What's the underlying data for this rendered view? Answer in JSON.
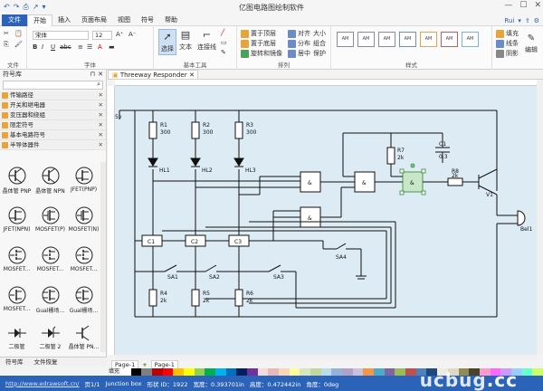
{
  "app_title": "亿图电路图绘制软件",
  "quick_access": [
    "↶",
    "↷",
    "⎙",
    "↗",
    "▾"
  ],
  "window_controls": [
    "—",
    "☐",
    "✕"
  ],
  "menu": [
    "文件",
    "开始",
    "插入",
    "页面布局",
    "视图",
    "符号",
    "帮助"
  ],
  "user": "Rui",
  "ribbon": {
    "file_group_label": "文件",
    "font_group_label": "字体",
    "tools_group_label": "基本工具",
    "arrange_group_label": "排列",
    "style_group_label": "样式",
    "edit_group_label": "编辑",
    "font_name": "宋体",
    "font_size": "12",
    "select_label": "选择",
    "text_label": "文本",
    "connector_label": "连接线",
    "arrange_items": [
      "置于顶层",
      "对齐",
      "大小",
      "置于底层",
      "分布",
      "组合",
      "旋转和镜像",
      "居中",
      "保护"
    ],
    "style_box_text": "AM",
    "fill_label": "填充",
    "line_label": "线条",
    "shadow_label": "阴影",
    "edit_label": "编辑"
  },
  "library": {
    "title": "符号库",
    "categories": [
      "传输路径",
      "开关和继电器",
      "变压器和绕组",
      "限定符号",
      "基本电路符号",
      "半导体器件"
    ],
    "shapes": [
      "晶体管 PNP",
      "晶体管 NPN",
      "JFET(PNP)",
      "JFET(NPN)",
      "MOSFET(P)",
      "MOSFET(N)",
      "MOSFET...",
      "MOSFET...",
      "MOSFET...",
      "MOSFET...",
      "Gual栅场...",
      "Gual栅场...",
      "二极管",
      "二极管 2",
      "晶体管 PN..."
    ],
    "bottom_tabs": [
      "符号库",
      "文件恢复"
    ]
  },
  "document_tab": "Threeway Responder",
  "circuit": {
    "source_label": "5v",
    "resistors_top": [
      {
        "label": "R1",
        "value": "300"
      },
      {
        "label": "R2",
        "value": "300"
      },
      {
        "label": "R3",
        "value": "300"
      }
    ],
    "leds": [
      "HL1",
      "HL2",
      "HL3"
    ],
    "latches": [
      "C1",
      "C2",
      "C3"
    ],
    "switches": [
      "SA1",
      "SA2",
      "SA3",
      "SA4"
    ],
    "resistors_bottom": [
      {
        "label": "R4",
        "value": "2k"
      },
      {
        "label": "R5",
        "value": "2k"
      },
      {
        "label": "R6",
        "value": "2k"
      }
    ],
    "r7": {
      "label": "R7",
      "value": "2k"
    },
    "c1": {
      "label": "C1",
      "value": "0.3"
    },
    "r8": {
      "label": "R8",
      "value": "2k"
    },
    "transistor": "V1",
    "bell": "Bel1",
    "gate_symbol": "&"
  },
  "page_bar": {
    "tab1": "Page-1",
    "add": "+",
    "tab2": "Page-1"
  },
  "palette_label": "填充",
  "colors": [
    "#ffffff",
    "#000000",
    "#7f7f7f",
    "#c00000",
    "#ff0000",
    "#ffc000",
    "#ffff00",
    "#92d050",
    "#00b050",
    "#00b0f0",
    "#0070c0",
    "#002060",
    "#7030a0",
    "#f2dcdb",
    "#e6b8b7",
    "#fcd5b4",
    "#ffff99",
    "#d8e4bc",
    "#c4d79b",
    "#b7dee8",
    "#95b3d7",
    "#b1a0c7",
    "#ccc0da",
    "#f79646",
    "#4bacc6",
    "#8064a2",
    "#9bbb59",
    "#c0504d",
    "#4f81bd",
    "#1f497d",
    "#eeece1",
    "#ddd9c3",
    "#938953",
    "#494429",
    "#ff99cc",
    "#ff66ff",
    "#cc99ff",
    "#99ccff",
    "#66ffcc",
    "#ccff66"
  ],
  "status": {
    "website": "http://www.edrawsoft.cn/",
    "page": "页1/1",
    "shape": "Junction box",
    "shape_id": "形状 ID：1922",
    "width": "宽度：0.393701in",
    "height": "高度：0.472442in",
    "angle": "角度：0deg"
  },
  "watermark": {
    "main": "ucbug",
    "suffix": ".cc"
  }
}
